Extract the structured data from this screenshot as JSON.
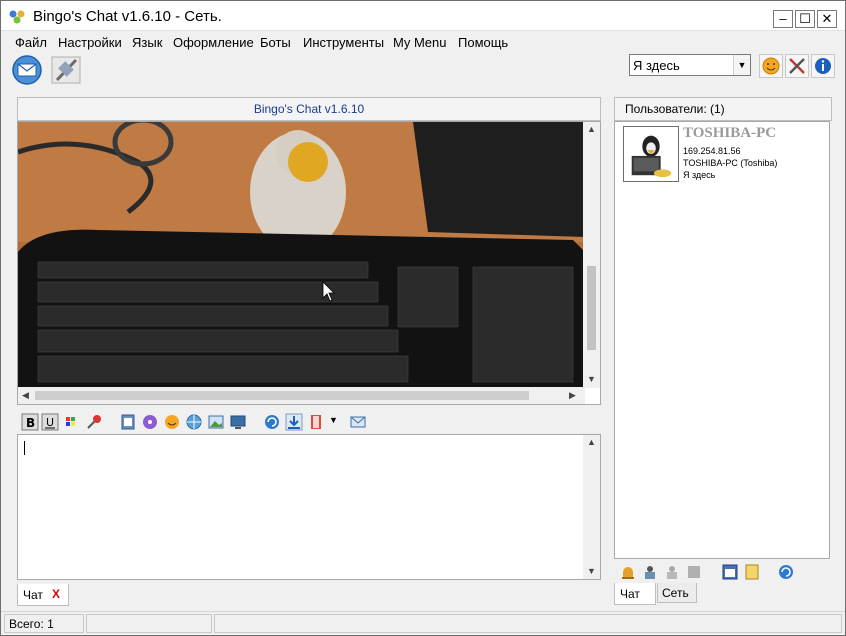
{
  "window": {
    "title": "Bingo's Chat v1.6.10 - Сеть."
  },
  "menu": [
    "Файл",
    "Настройки",
    "Язык",
    "Оформление",
    "Боты",
    "Инструменты",
    "My Menu",
    "Помощь"
  ],
  "toolbar": {
    "status_value": "Я здесь",
    "icons": [
      "message-icon",
      "satellite-icon",
      "smiley-icon",
      "tools-icon",
      "info-icon"
    ]
  },
  "chat": {
    "header": "Bingo's Chat v1.6.10",
    "input_value": "",
    "tab_label": "Чат",
    "tab_close": "X",
    "format_icons": [
      "bold-icon",
      "underline-icon",
      "color-palette-icon",
      "pin-icon",
      "image-icon",
      "cd-icon",
      "smiley-icon",
      "globe-icon",
      "picture-icon",
      "monitor-icon",
      "refresh-icon",
      "download-icon",
      "bookmark-icon",
      "envelope-icon"
    ]
  },
  "users": {
    "header": "Пользователи: (1)",
    "list": [
      {
        "name": "TOSHIBA-PC",
        "ip": "169.254.81.56",
        "host": "TOSHIBA-PC (Toshiba)",
        "status": "Я здесь"
      }
    ],
    "tabs": [
      "Чат",
      "Сеть"
    ],
    "tool_icons": [
      "bell-icon",
      "printer-icon",
      "user-gray-icon",
      "stop-gray-icon",
      "window-icon",
      "notes-icon",
      "refresh-icon"
    ]
  },
  "statusbar": {
    "total": "Всего: 1"
  },
  "colors": {
    "header_text": "#1a3c8c",
    "user_name": "#9a9a9a",
    "close_x": "#e00000"
  }
}
